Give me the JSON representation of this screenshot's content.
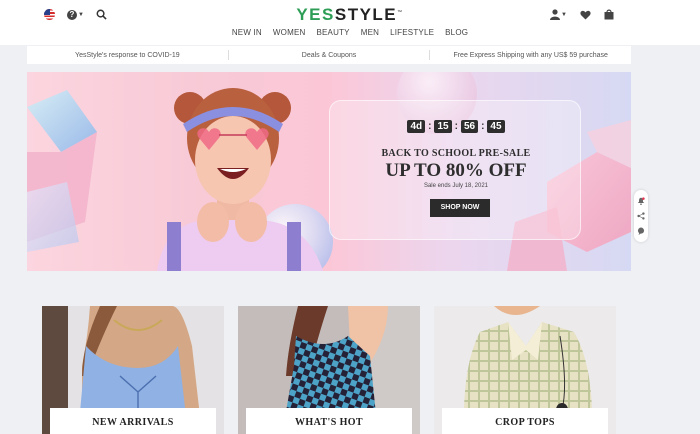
{
  "header": {
    "logo_yes": "YES",
    "logo_style": "STYLE",
    "nav": [
      "NEW IN",
      "WOMEN",
      "BEAUTY",
      "MEN",
      "LIFESTYLE",
      "BLOG"
    ]
  },
  "infobar": {
    "items": [
      "YesStyle's response to COVID-19",
      "Deals & Coupons",
      "Free Express Shipping with any US$ 59 purchase"
    ]
  },
  "hero": {
    "timer": {
      "days": "4d",
      "hours": "15",
      "minutes": "56",
      "seconds": "45"
    },
    "subtitle": "BACK TO SCHOOL PRE-SALE",
    "headline": "UP TO 80% OFF",
    "ends": "Sale ends July 18, 2021",
    "cta": "SHOP NOW"
  },
  "categories": [
    {
      "label": "NEW ARRIVALS"
    },
    {
      "label": "WHAT'S HOT"
    },
    {
      "label": "CROP TOPS"
    }
  ],
  "icons": {
    "flag": "us-flag-icon",
    "help": "help-icon",
    "search": "search-icon",
    "account": "user-icon",
    "wishlist": "heart-icon",
    "cart": "shopping-bag-icon"
  },
  "colors": {
    "brand_green": "#2e9e57",
    "button_dark": "#2b2b2b"
  }
}
